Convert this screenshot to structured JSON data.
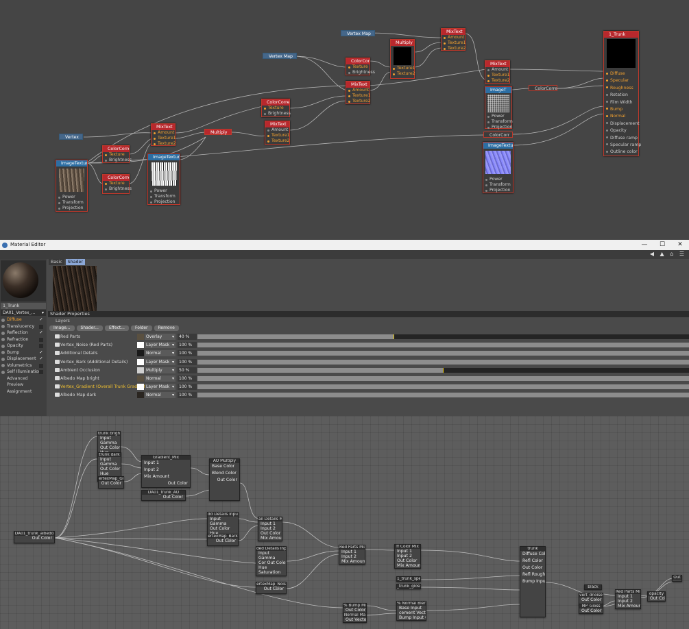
{
  "top_nodes": {
    "vertex_map_1": "Vertex Map",
    "vertex_map_2": "Vertex Map",
    "vertex": "Vertex",
    "multiply_1": {
      "title": "Multiply",
      "ports": [
        "Texture1",
        "Texture2"
      ]
    },
    "mixtext_top": {
      "title": "MixText",
      "ports": [
        "Amount",
        "Texture1",
        "Texture2"
      ]
    },
    "colorcorr_a": {
      "title": "ColorCorre",
      "ports": [
        "Texture",
        "Brightness"
      ]
    },
    "mixtext_b": {
      "title": "MixText",
      "ports": [
        "Amount",
        "Texture1",
        "Texture2"
      ]
    },
    "colorcorr_c": {
      "title": "ColorCorre",
      "ports": [
        "Texture",
        "Brightness"
      ]
    },
    "mixtext_d": {
      "title": "MixText",
      "ports": [
        "Amount",
        "Texture1",
        "Texture2"
      ]
    },
    "mixtext_left": {
      "title": "MixText",
      "ports": [
        "Amount",
        "Texture1",
        "Texture2"
      ]
    },
    "multiply_2": "Multiply",
    "colorcorr_e": {
      "title": "ColorCorre",
      "ports": [
        "Texture",
        "Brightness"
      ]
    },
    "colorcorr_f": {
      "title": "ColorCorre",
      "ports": [
        "Texture",
        "Brightness"
      ]
    },
    "imagetex_left": {
      "title": "ImageTexture",
      "ports": [
        "Power",
        "Transform",
        "Projection"
      ]
    },
    "imagetex_mid": {
      "title": "ImageTexture",
      "ports": [
        "Power",
        "Transform",
        "Projection"
      ]
    },
    "mixtext_right": {
      "title": "MixText",
      "ports": [
        "Amount",
        "Texture1",
        "Texture2"
      ]
    },
    "image_t": {
      "title": "ImageT",
      "ports": [
        "Power",
        "Transform",
        "Projection"
      ]
    },
    "colorcorre_g": "ColorCorre",
    "colorcorr_h": "ColorCorr",
    "imagetex_normal": {
      "title": "ImageTexture",
      "ports": [
        "Power",
        "Transform",
        "Projection"
      ]
    },
    "material": {
      "title": "1_Trunk",
      "ports": [
        "Diffuse",
        "Specular",
        "Roughness",
        "Rotation",
        "Film Width",
        "Bump",
        "Normal",
        "Displacement",
        "Opacity",
        "Diffuse ramp",
        "Specular ramp",
        "Outline color"
      ]
    }
  },
  "editor": {
    "title": "Material Editor",
    "window_buttons": [
      "—",
      "☐",
      "✕"
    ],
    "material_name": "1_Trunk",
    "shader_dropdown": "DA01_Vertex_...",
    "channels": [
      {
        "label": "Diffuse",
        "checked": true
      },
      {
        "label": "Translucency",
        "checked": false
      },
      {
        "label": "Reflection",
        "checked": true
      },
      {
        "label": "Refraction",
        "checked": false
      },
      {
        "label": "Opacity",
        "checked": false
      },
      {
        "label": "Bump",
        "checked": true
      },
      {
        "label": "Displacement",
        "checked": true
      },
      {
        "label": "Volumetrics",
        "checked": false
      },
      {
        "label": "Self Illumination",
        "checked": false
      }
    ],
    "extra_tabs": [
      "Advanced",
      "Preview",
      "Assignment"
    ],
    "tabs": [
      "Basic",
      "Shader"
    ],
    "shader_properties": "Shader Properties",
    "layers_label": "Layers",
    "buttons": [
      "Image...",
      "Shader...",
      "Effect...",
      "Folder",
      "Remove"
    ],
    "layers": [
      {
        "name": "Red Parts",
        "mode": "Overlay",
        "percent": "40 %",
        "value": 40,
        "swatch": "#5a5040"
      },
      {
        "name": "Vertex_Noise (Red Parts)",
        "mode": "Layer Mask",
        "percent": "100 %",
        "value": 100,
        "swatch": "#ffffff"
      },
      {
        "name": "Additional Details",
        "mode": "Normal",
        "percent": "100 %",
        "value": 100,
        "swatch": "#1a1a1a"
      },
      {
        "name": "Vertex_Bark (Additional Details)",
        "mode": "Layer Mask",
        "percent": "100 %",
        "value": 100,
        "swatch": "#ffffff"
      },
      {
        "name": "Ambient Occlusion",
        "mode": "Multiply",
        "percent": "50 %",
        "value": 50,
        "swatch": "#d0d0d0"
      },
      {
        "name": "Albedo Map bright",
        "mode": "Normal",
        "percent": "100 %",
        "value": 100,
        "swatch": "#5a5040"
      },
      {
        "name": "Vertex_Gradient (Overall Trunk Gradient)",
        "mode": "Layer Mask",
        "percent": "100 %",
        "value": 100,
        "swatch": "#ffffff",
        "highlight": true
      },
      {
        "name": "Albedo Map dark",
        "mode": "Normal",
        "percent": "100 %",
        "value": 100,
        "swatch": "#2a2520"
      }
    ]
  },
  "bottom_nodes": {
    "cc_bright": {
      "title": "trunk bright",
      "rows": [
        "Input",
        "Gamma",
        "Out Color",
        "Hue",
        "Saturation"
      ]
    },
    "cc_dark": {
      "title": "trunk dark",
      "rows": [
        "Input",
        "Gamma",
        "Out Color",
        "Hue",
        "Saturation"
      ]
    },
    "vertex_gradient": {
      "title": "ertexMap_Grad",
      "rows": [
        "Out Color"
      ]
    },
    "gradient_mix": {
      "title": "Gradient_Mix",
      "rows": [
        "Input 1",
        "Input 2",
        "Mix Amount"
      ],
      "out": "Out Color"
    },
    "ao_multiply": {
      "title": "AO Multiply",
      "rows": [
        "Base Color",
        "Blend Color"
      ],
      "out": "Out Color"
    },
    "ao_trunk": {
      "title": "DA01_trunk_AO",
      "rows": [
        "Out Color"
      ]
    },
    "trunk_albedo": {
      "title": "DA01_trunk_albedo",
      "rows": [
        "Out Color"
      ]
    },
    "detail_input": {
      "title": "dd Details Inpu",
      "rows": [
        "Input",
        "Gamma",
        "Out Color",
        "Hue",
        "Saturation"
      ]
    },
    "vertex_bark": {
      "title": "ertexMap_Bark",
      "rows": [
        "Out Color"
      ]
    },
    "details_mix": {
      "title": "ail Details Mi",
      "rows": [
        "Input 1",
        "Input 2",
        "Out Color",
        "Mix Amount"
      ]
    },
    "detail_in2": {
      "title": "ded Details Inp",
      "rows": [
        "Input",
        "Gamma",
        "Cor Out Color",
        "Hue",
        "Saturation"
      ]
    },
    "vertex_noise": {
      "title": "ertexMap_Nois",
      "rows": [
        "Out Color"
      ]
    },
    "red_parts_mix": {
      "title": "Red Parts Mix",
      "rows": [
        "Input 1",
        "Input 2",
        "Mix Amount"
      ]
    },
    "color_mix": {
      "title": "ff Color Mix",
      "rows": [
        "Input 1",
        "Input 2",
        "Out Color",
        "Mix Amount"
      ]
    },
    "trunk_spec": {
      "title": "1_trunk_spec",
      "rows": []
    },
    "trunk_gloss": {
      "title": "_trunk_gloss",
      "rows": []
    },
    "normal_mix": {
      "title": "% Normal Blende",
      "rows": [
        "Base Input",
        "cement Vecto",
        "Bump Input 0"
      ]
    },
    "bump_mix": {
      "title": "% Bump Mix",
      "rows": [
        "Out Color"
      ]
    },
    "normal_map": {
      "title": "Normal Ma",
      "rows": [
        "Out Vecto"
      ]
    },
    "trunk_main": {
      "title": "trunk",
      "rows": [
        "Diffuse Col",
        "Refl Color",
        "Out Color",
        "Refl Rough",
        "Bump Inpu"
      ]
    },
    "black": {
      "title": "black",
      "rows": []
    },
    "vert_dnoise": {
      "title": "vert_dnoise",
      "rows": [
        "Out Color"
      ]
    },
    "bark_gloss": {
      "title": "MP_Gloss",
      "rows": [
        "Out Color"
      ]
    },
    "red_parts_mix2": {
      "title": "Red Parts Mix",
      "rows": [
        "Input 1",
        "Input 2",
        "Mix Amount"
      ]
    },
    "opacity": {
      "title": "opacity",
      "rows": [
        "Out Colo"
      ]
    },
    "out": {
      "title": "Out",
      "rows": []
    }
  }
}
